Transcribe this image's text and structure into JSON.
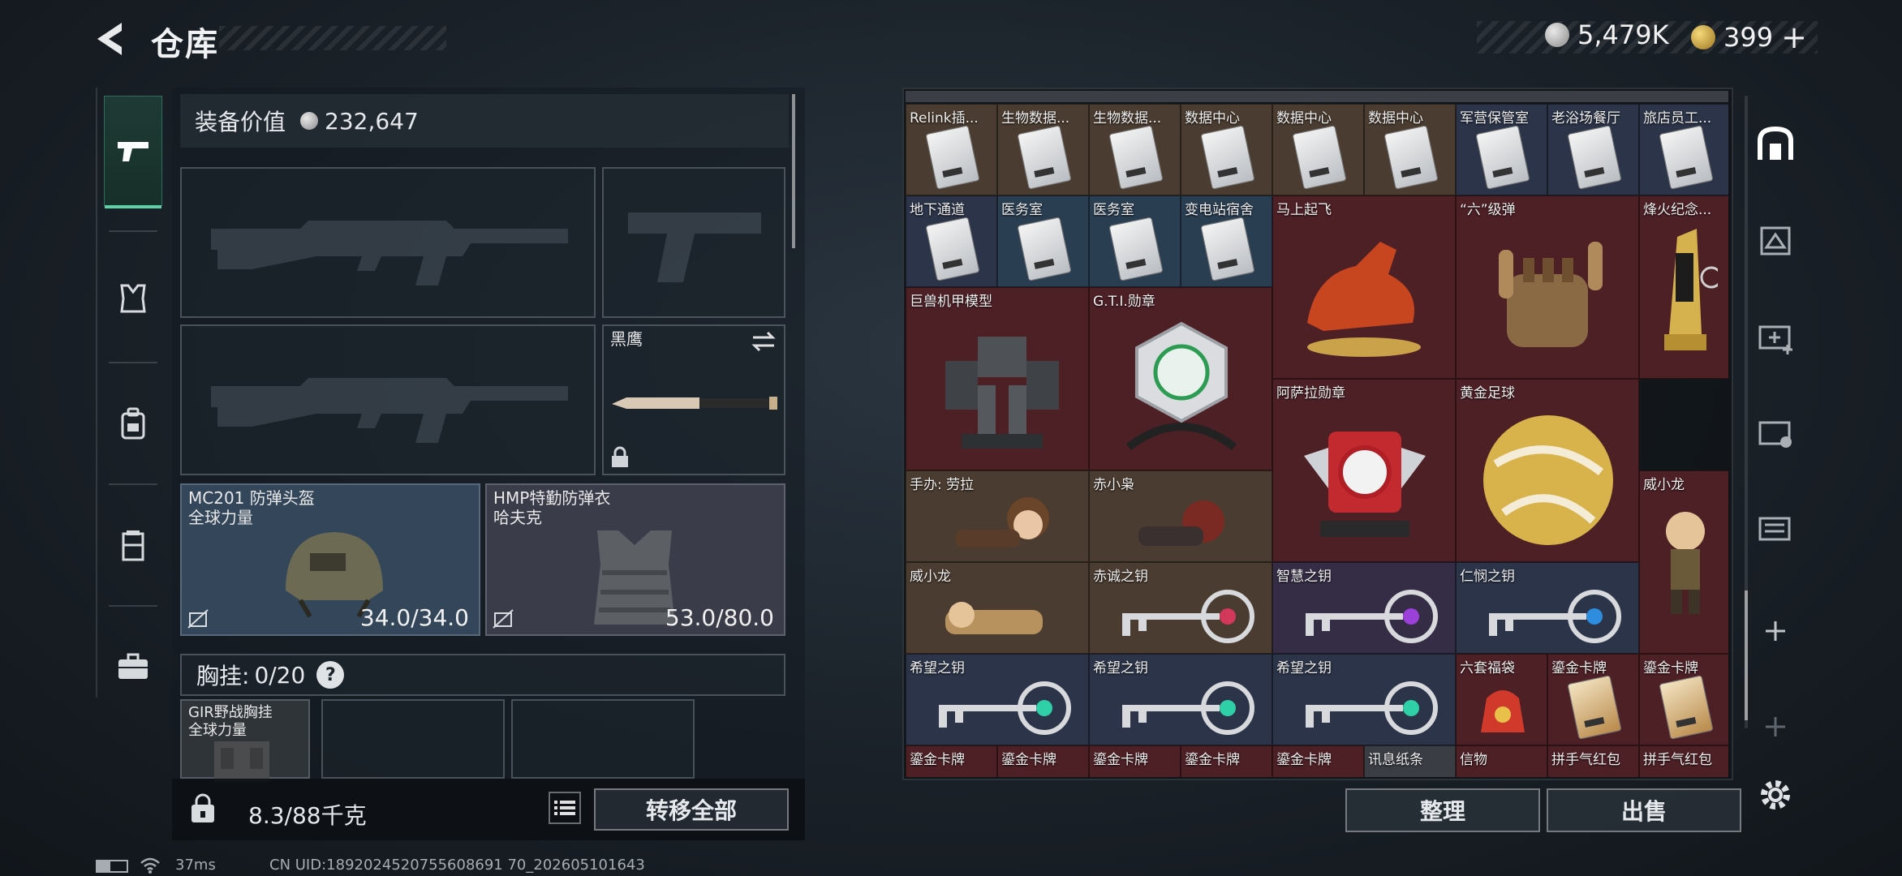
{
  "header": {
    "title": "仓库"
  },
  "currency": {
    "silver": "5,479K",
    "gold": "399",
    "gold_add": "+"
  },
  "left_tabs": [
    "weapon-tab",
    "armor-tab",
    "backpack-tab",
    "vest-tab",
    "case-tab"
  ],
  "equipment": {
    "value_label": "装备价值",
    "value": "232,647",
    "melee": {
      "name": "黑鹰"
    },
    "helmet": {
      "name": "MC201 防弹头盔",
      "brand": "全球力量",
      "durability": "34.0/34.0"
    },
    "body_armor": {
      "name": "HMP特勤防弹衣",
      "brand": "哈夫克",
      "durability": "53.0/80.0"
    },
    "chest_label": "胸挂:",
    "chest_capacity": "0/20",
    "chest_rig": {
      "name": "GIR野战胸挂",
      "brand": "全球力量"
    }
  },
  "bottom": {
    "weight": "8.3/88千克",
    "transfer_all": "转移全部"
  },
  "storage": {
    "items": [
      {
        "label": "Relink插..."
      },
      {
        "label": "生物数据..."
      },
      {
        "label": "生物数据..."
      },
      {
        "label": "数据中心"
      },
      {
        "label": "数据中心"
      },
      {
        "label": "数据中心"
      },
      {
        "label": "军营保管室"
      },
      {
        "label": "老浴场餐厅"
      },
      {
        "label": "旅店员工..."
      },
      {
        "label": "地下通道"
      },
      {
        "label": "医务室"
      },
      {
        "label": "医务室"
      },
      {
        "label": "变电站宿舍"
      },
      {
        "label": "马上起飞"
      },
      {
        "label": "“六”级弹"
      },
      {
        "label": "烽火纪念..."
      },
      {
        "label": "巨兽机甲模型"
      },
      {
        "label": "G.T.I.勋章"
      },
      {
        "label": "阿萨拉勋章"
      },
      {
        "label": "黄金足球"
      },
      {
        "label": "手办: 劳拉"
      },
      {
        "label": "赤小枭"
      },
      {
        "label": "威小龙"
      },
      {
        "label": "威小龙"
      },
      {
        "label": "赤诚之钥"
      },
      {
        "label": "智慧之钥"
      },
      {
        "label": "仁悯之钥"
      },
      {
        "label": "希望之钥"
      },
      {
        "label": "希望之钥"
      },
      {
        "label": "希望之钥"
      },
      {
        "label": "六套福袋"
      },
      {
        "label": "鎏金卡牌"
      },
      {
        "label": "鎏金卡牌"
      },
      {
        "label": "鎏金卡牌"
      },
      {
        "label": "鎏金卡牌"
      },
      {
        "label": "鎏金卡牌"
      },
      {
        "label": "鎏金卡牌"
      },
      {
        "label": "鎏金卡牌"
      },
      {
        "label": "讯息纸条"
      },
      {
        "label": "信物"
      },
      {
        "label": "拼手气红包"
      },
      {
        "label": "拼手气红包"
      }
    ]
  },
  "actions": {
    "sort": "整理",
    "sell": "出售"
  },
  "status": {
    "ping": "37ms",
    "uid": "CN UID:1892024520755608691 70_202605101643"
  },
  "colors": {
    "accent": "#5fd1a7",
    "rare_red": "#4d2026",
    "gold_item": "#d8b24a"
  }
}
